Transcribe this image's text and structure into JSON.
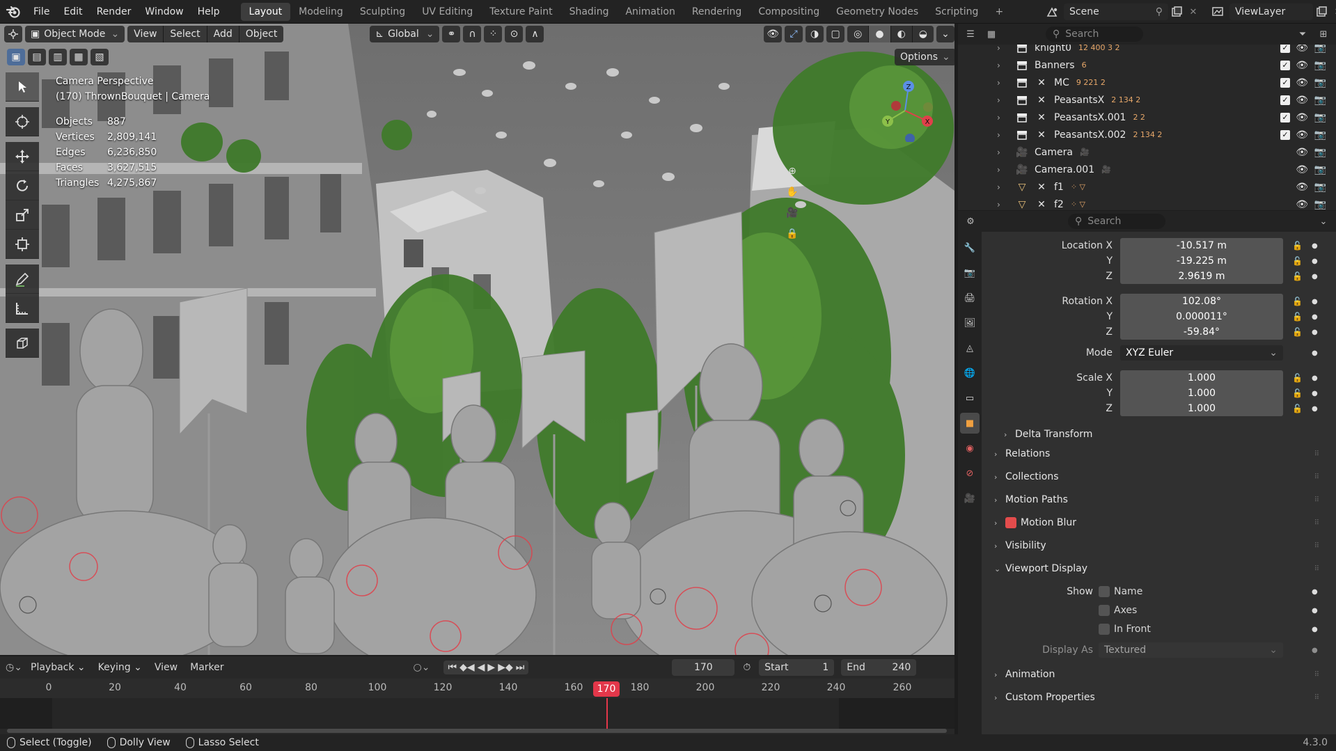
{
  "menu": [
    "File",
    "Edit",
    "Render",
    "Window",
    "Help"
  ],
  "workspaces": [
    "Layout",
    "Modeling",
    "Sculpting",
    "UV Editing",
    "Texture Paint",
    "Shading",
    "Animation",
    "Rendering",
    "Compositing",
    "Geometry Nodes",
    "Scripting"
  ],
  "active_workspace": "Layout",
  "scene_name": "Scene",
  "view_layer": "ViewLayer",
  "viewport": {
    "mode": "Object Mode",
    "menus": [
      "View",
      "Select",
      "Add",
      "Object"
    ],
    "orientation": "Global",
    "options_label": "Options",
    "title_line1": "Camera Perspective",
    "title_line2": "(170) ThrownBouquet | Camera",
    "stats": [
      {
        "label": "Objects",
        "value": "887"
      },
      {
        "label": "Vertices",
        "value": "2,809,141"
      },
      {
        "label": "Edges",
        "value": "6,236,850"
      },
      {
        "label": "Faces",
        "value": "3,627,515"
      },
      {
        "label": "Triangles",
        "value": "4,275,867"
      }
    ]
  },
  "outliner": {
    "search_placeholder": "Search",
    "rows": [
      {
        "name": "knight0",
        "icon": "collection",
        "ext": "12 400 3 2",
        "checked": true
      },
      {
        "name": "Banners",
        "icon": "collection",
        "ext": "6",
        "checked": true
      },
      {
        "name": "MC",
        "icon": "collection",
        "ext": "9 221 2",
        "checked": true
      },
      {
        "name": "PeasantsX",
        "icon": "collection",
        "ext": "2 134 2",
        "checked": true
      },
      {
        "name": "PeasantsX.001",
        "icon": "collection",
        "ext": "2 2",
        "checked": true
      },
      {
        "name": "PeasantsX.002",
        "icon": "collection",
        "ext": "2 134 2",
        "checked": true
      },
      {
        "name": "Camera",
        "icon": "camera",
        "ext": "",
        "checked": false
      },
      {
        "name": "Camera.001",
        "icon": "camera",
        "ext": "",
        "checked": false
      },
      {
        "name": "f1",
        "icon": "mesh",
        "ext": "",
        "checked": false
      },
      {
        "name": "f2",
        "icon": "mesh",
        "ext": "",
        "checked": false
      }
    ]
  },
  "properties": {
    "search_placeholder": "Search",
    "location": {
      "label": "Location X",
      "x": "-10.517 m",
      "y": "-19.225 m",
      "z": "2.9619 m"
    },
    "rotation": {
      "label": "Rotation X",
      "x": "102.08°",
      "y": "0.000011°",
      "z": "-59.84°"
    },
    "mode_label": "Mode",
    "mode_value": "XYZ Euler",
    "scale": {
      "label": "Scale X",
      "x": "1.000",
      "y": "1.000",
      "z": "1.000"
    },
    "y_label": "Y",
    "z_label": "Z",
    "delta_transform": "Delta Transform",
    "sections": [
      "Relations",
      "Collections",
      "Motion Paths",
      "Motion Blur",
      "Visibility",
      "Viewport Display"
    ],
    "show_label": "Show",
    "show_opts": [
      "Name",
      "Axes",
      "In Front"
    ],
    "display_as_label": "Display As",
    "display_as_value": "Textured",
    "sections2": [
      "Animation",
      "Custom Properties"
    ]
  },
  "timeline": {
    "menus": [
      "Playback",
      "Keying",
      "View",
      "Marker"
    ],
    "current_frame": "170",
    "start_label": "Start",
    "start": "1",
    "end_label": "End",
    "end": "240",
    "ticks": [
      "0",
      "20",
      "40",
      "60",
      "80",
      "100",
      "120",
      "140",
      "160",
      "170",
      "180",
      "200",
      "220",
      "240",
      "260"
    ]
  },
  "statusbar": {
    "items": [
      "Select (Toggle)",
      "Dolly View",
      "Lasso Select"
    ],
    "version": "4.3.0"
  },
  "colors": {
    "accent": "#e3374a",
    "header": "#232323",
    "panel": "#303030",
    "field": "#545454"
  }
}
